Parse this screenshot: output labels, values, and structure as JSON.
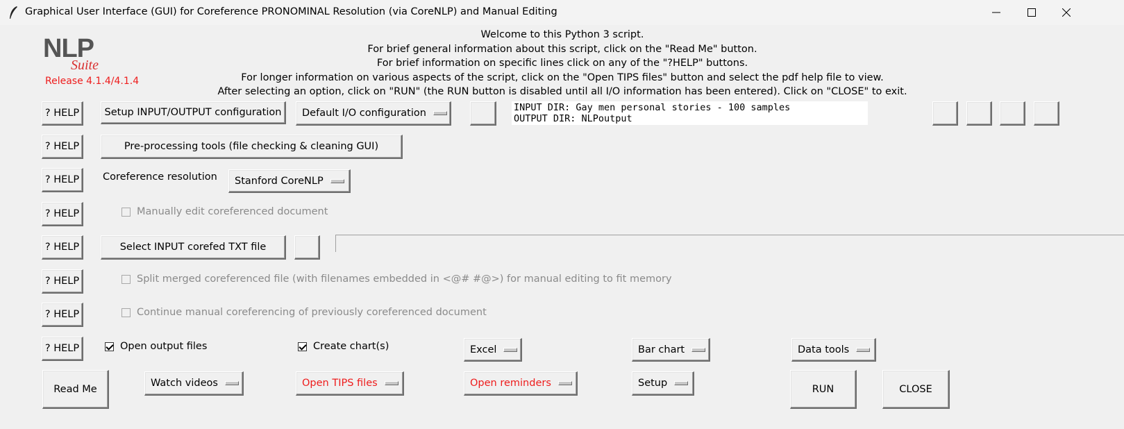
{
  "window": {
    "title": "Graphical User Interface (GUI) for Coreference PRONOMINAL Resolution (via CoreNLP) and Manual Editing"
  },
  "logo": {
    "main": "NLP",
    "sub": "Suite",
    "release": "Release 4.1.4/4.1.4"
  },
  "welcome": {
    "line1": "Welcome to this Python 3 script.",
    "line2": "For brief general information about this script, click on the \"Read Me\" button.",
    "line3": "For brief information on specific lines click on any of the \"?HELP\" buttons.",
    "line4": "For longer information on various aspects of the script, click on the \"Open TIPS files\" button and select the pdf help file to view.",
    "line5": "After selecting an option, click on \"RUN\" (the RUN button is disabled until all I/O information has been entered).   Click on \"CLOSE\" to exit."
  },
  "help_label": "? HELP",
  "io": {
    "setup_button": "Setup INPUT/OUTPUT configuration",
    "config_menu": "Default I/O configuration",
    "input_line": "INPUT DIR: Gay men personal stories - 100 samples",
    "output_line": "OUTPUT DIR: NLPoutput"
  },
  "preprocessing_button": "Pre-processing tools (file checking & cleaning GUI)",
  "coref": {
    "label": "Coreference resolution",
    "menu": "Stanford CoreNLP"
  },
  "manual_edit": {
    "label": "Manually edit coreferenced document",
    "checked": false,
    "enabled": false
  },
  "select_input_button": "Select INPUT corefed TXT file",
  "split_merged": {
    "label": "Split merged coreferenced file (with filenames embedded in <@# #@>) for manual editing to fit memory",
    "checked": false,
    "enabled": false
  },
  "continue_manual": {
    "label": "Continue manual coreferencing of previously coreferenced document",
    "checked": false,
    "enabled": false
  },
  "output_options": {
    "open_output": {
      "label": "Open output files",
      "checked": true
    },
    "create_charts": {
      "label": "Create chart(s)",
      "checked": true
    },
    "chart_package": "Excel",
    "chart_type": "Bar chart",
    "data_tools": "Data tools"
  },
  "bottom": {
    "read_me": "Read Me",
    "watch_videos": "Watch videos",
    "open_tips": "Open TIPS files",
    "open_reminders": "Open reminders",
    "setup": "Setup",
    "run": "RUN",
    "close": "CLOSE"
  },
  "colors": {
    "accent_red": "#ee1c1c",
    "background": "#f0f0f0"
  }
}
